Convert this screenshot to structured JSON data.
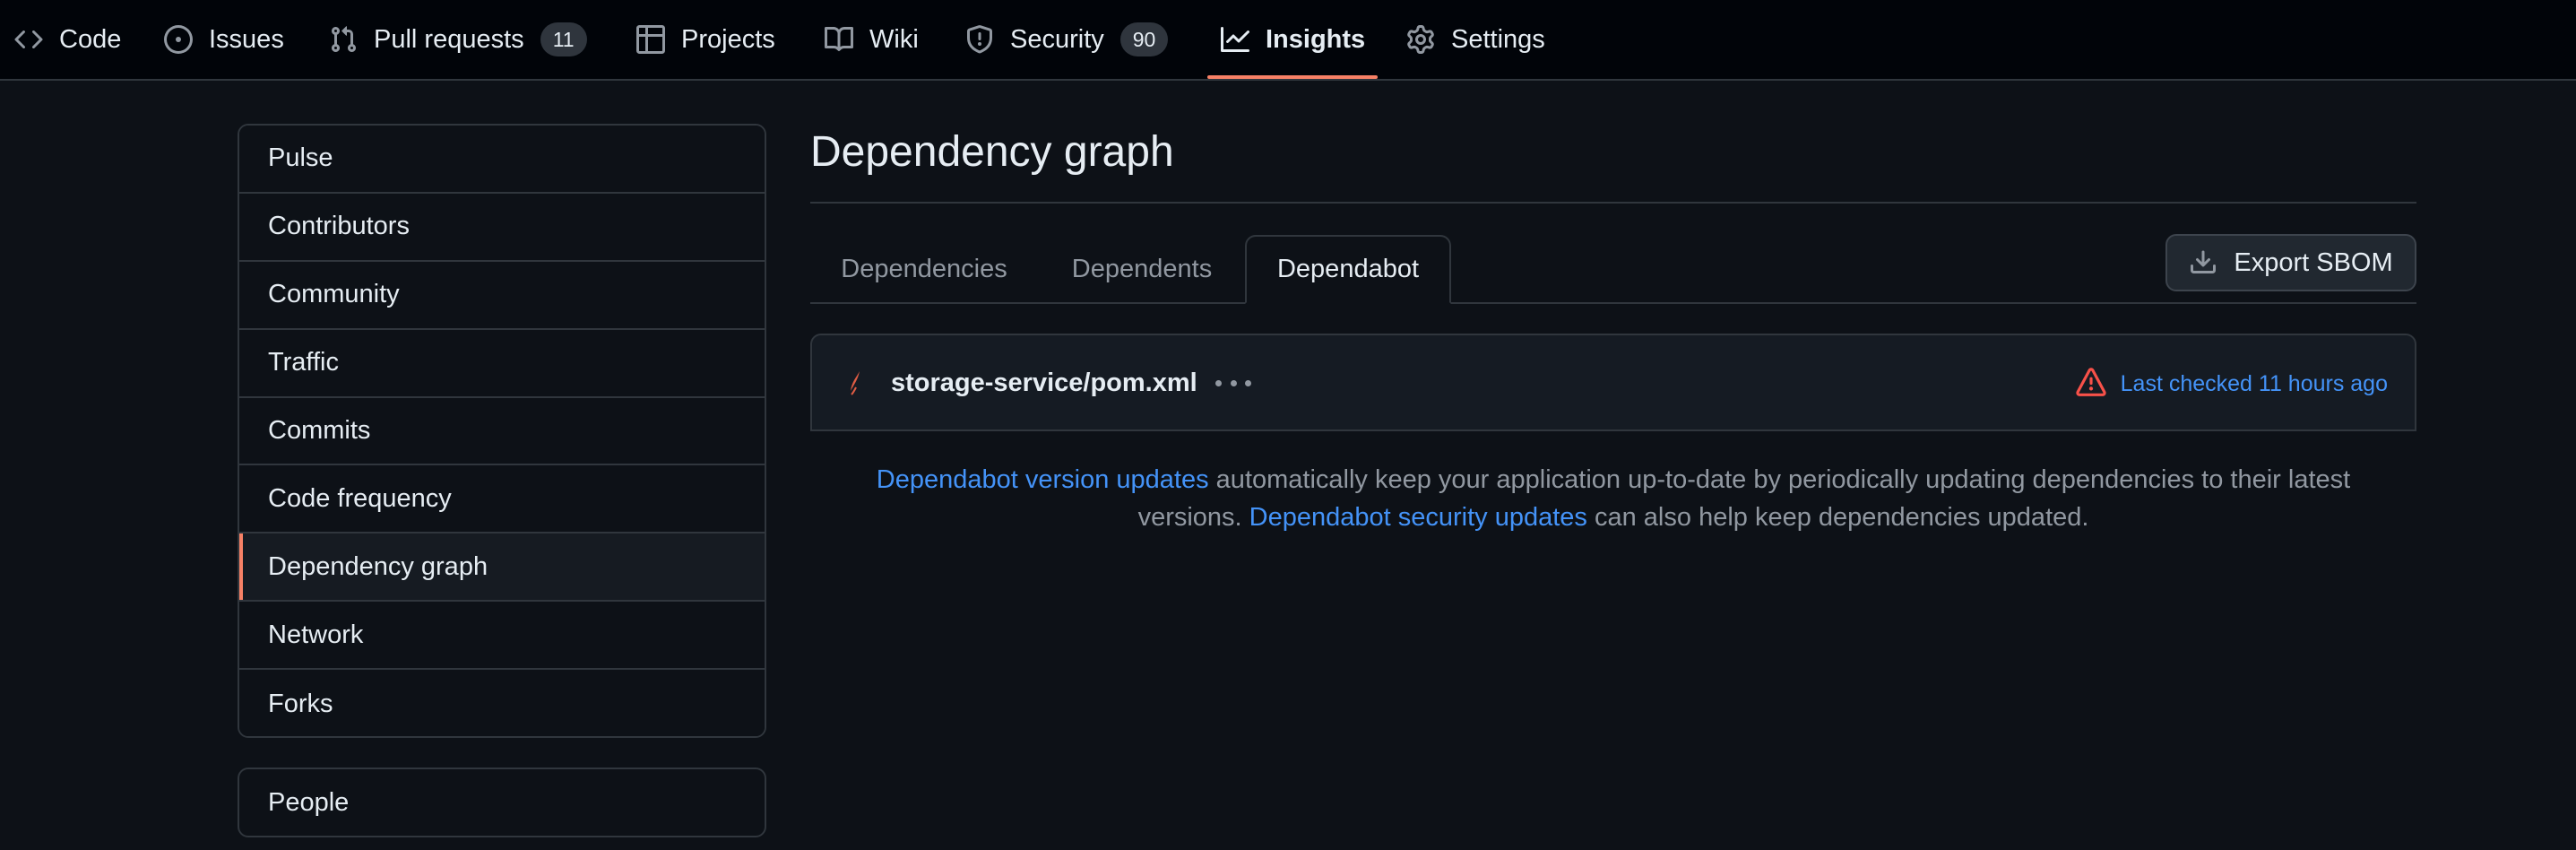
{
  "repo_nav": {
    "items": [
      {
        "label": "Code",
        "icon": "code-icon"
      },
      {
        "label": "Issues",
        "icon": "issue-opened-icon"
      },
      {
        "label": "Pull requests",
        "icon": "git-pull-request-icon",
        "counter": "11"
      },
      {
        "label": "Projects",
        "icon": "table-icon"
      },
      {
        "label": "Wiki",
        "icon": "book-icon"
      },
      {
        "label": "Security",
        "icon": "shield-icon",
        "counter": "90"
      },
      {
        "label": "Insights",
        "icon": "graph-icon",
        "active": true
      },
      {
        "label": "Settings",
        "icon": "gear-icon"
      }
    ]
  },
  "sidebar": {
    "items": [
      {
        "label": "Pulse"
      },
      {
        "label": "Contributors"
      },
      {
        "label": "Community"
      },
      {
        "label": "Traffic"
      },
      {
        "label": "Commits"
      },
      {
        "label": "Code frequency"
      },
      {
        "label": "Dependency graph",
        "selected": true
      },
      {
        "label": "Network"
      },
      {
        "label": "Forks"
      }
    ],
    "secondary_items": [
      {
        "label": "People"
      }
    ]
  },
  "main": {
    "title": "Dependency graph",
    "tabs": [
      {
        "label": "Dependencies"
      },
      {
        "label": "Dependents"
      },
      {
        "label": "Dependabot",
        "active": true
      }
    ],
    "export_button": {
      "label": "Export SBOM",
      "icon": "download-icon"
    },
    "manifest": {
      "file_name": "storage-service/pom.xml",
      "file_icon": "java-file-icon",
      "menu_icon": "kebab-horizontal-icon",
      "status_icon": "alert-icon",
      "status_text": "Last checked 11 hours ago"
    },
    "info": {
      "link1": "Dependabot version updates",
      "text1": " automatically keep your application up-to-date by periodically updating dependencies to their latest",
      "text2": "versions. ",
      "link2": "Dependabot security updates",
      "text3": " can also help keep dependencies updated."
    }
  },
  "colors": {
    "accent": "#f78166",
    "link": "#4493f8",
    "warning": "#f85149",
    "background": "#0d1117"
  }
}
